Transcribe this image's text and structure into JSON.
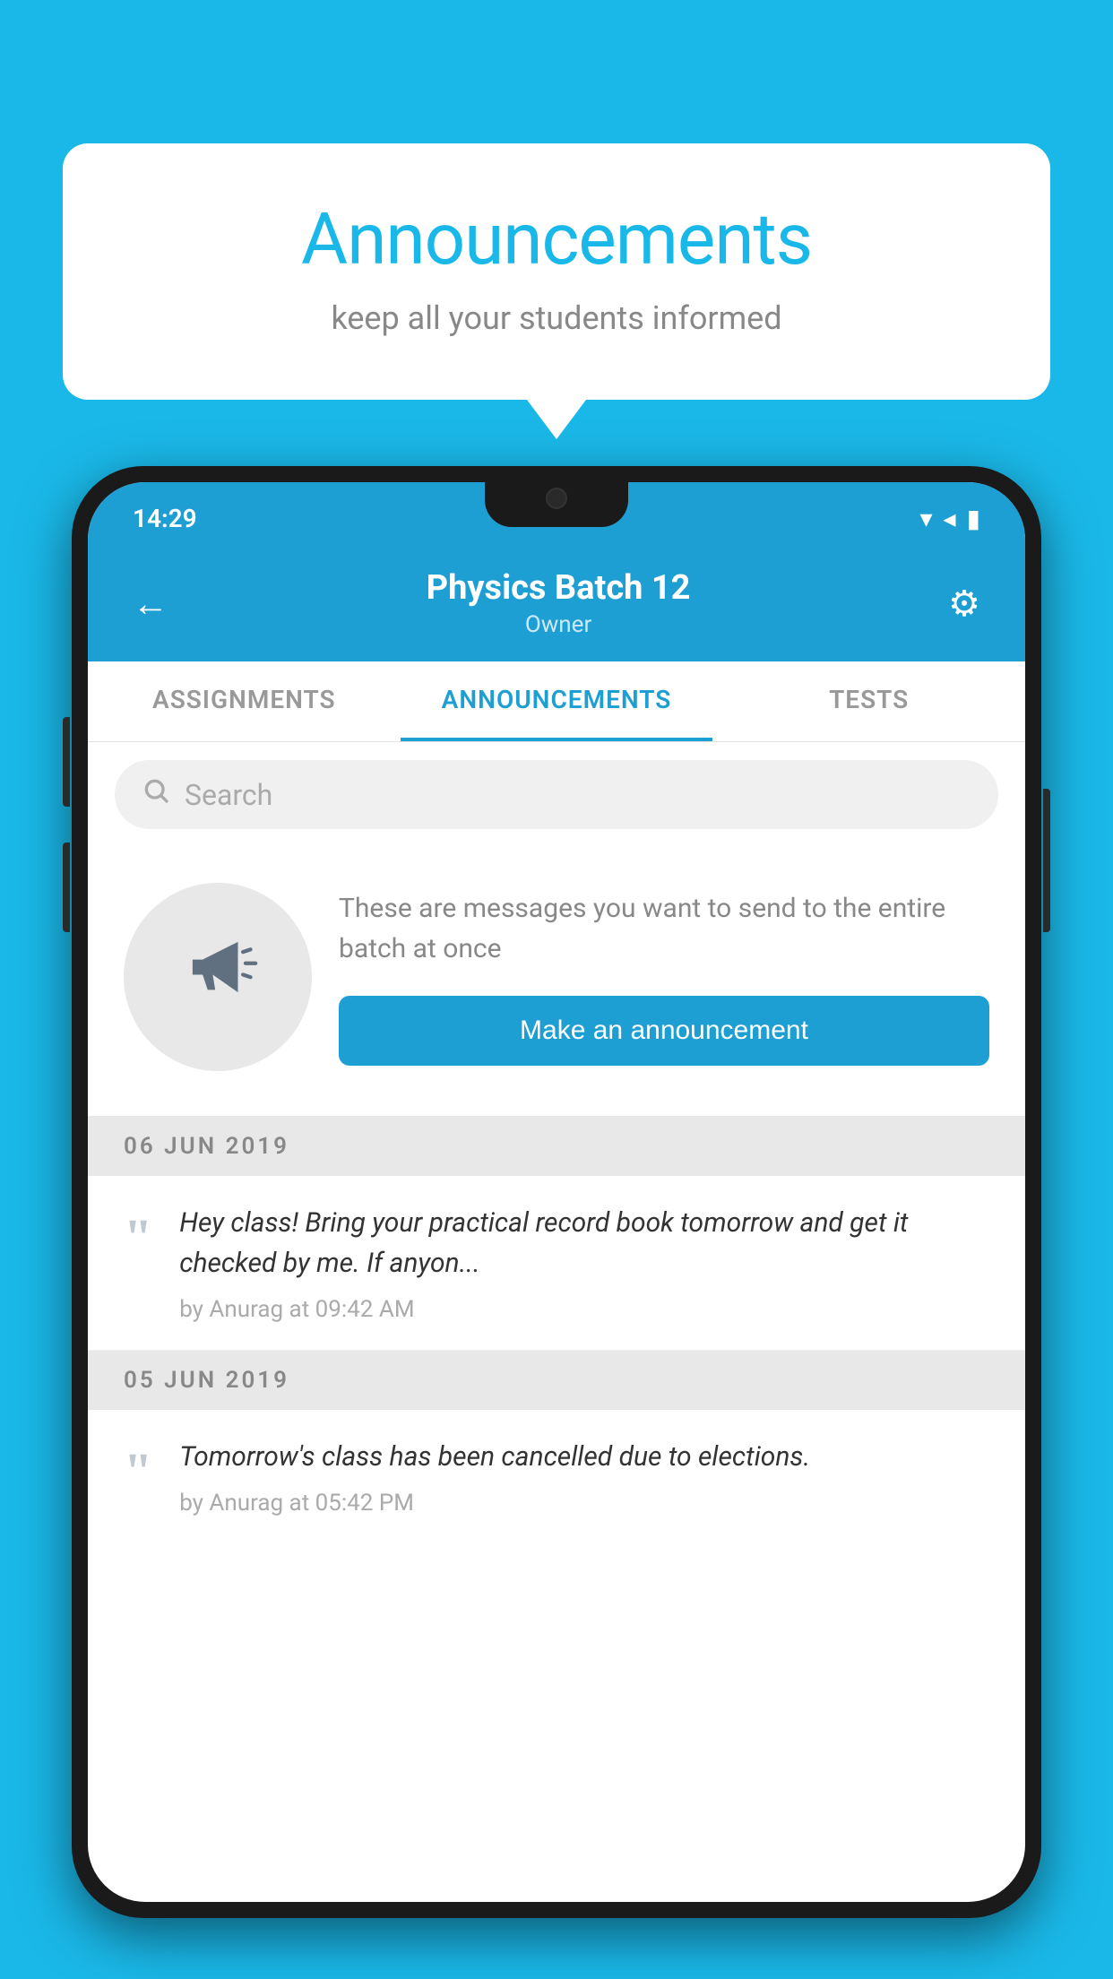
{
  "speech_bubble": {
    "title": "Announcements",
    "subtitle": "keep all your students informed"
  },
  "status_bar": {
    "time": "14:29",
    "wifi": "▼",
    "signal": "▲",
    "battery": "▮"
  },
  "header": {
    "title": "Physics Batch 12",
    "subtitle": "Owner",
    "back_label": "←",
    "gear_label": "⚙"
  },
  "tabs": [
    {
      "label": "ASSIGNMENTS",
      "active": false
    },
    {
      "label": "ANNOUNCEMENTS",
      "active": true
    },
    {
      "label": "TESTS",
      "active": false
    }
  ],
  "search": {
    "placeholder": "Search"
  },
  "promo": {
    "description": "These are messages you want to send to the entire batch at once",
    "button_label": "Make an announcement"
  },
  "announcements": [
    {
      "date": "06  JUN  2019",
      "text": "Hey class! Bring your practical record book tomorrow and get it checked by me. If anyon...",
      "meta": "by Anurag at 09:42 AM"
    },
    {
      "date": "05  JUN  2019",
      "text": "Tomorrow's class has been cancelled due to elections.",
      "meta": "by Anurag at 05:42 PM"
    }
  ],
  "colors": {
    "primary": "#1e9fd4",
    "background": "#1ab8e8",
    "phone_bg": "#1a1a1a"
  }
}
